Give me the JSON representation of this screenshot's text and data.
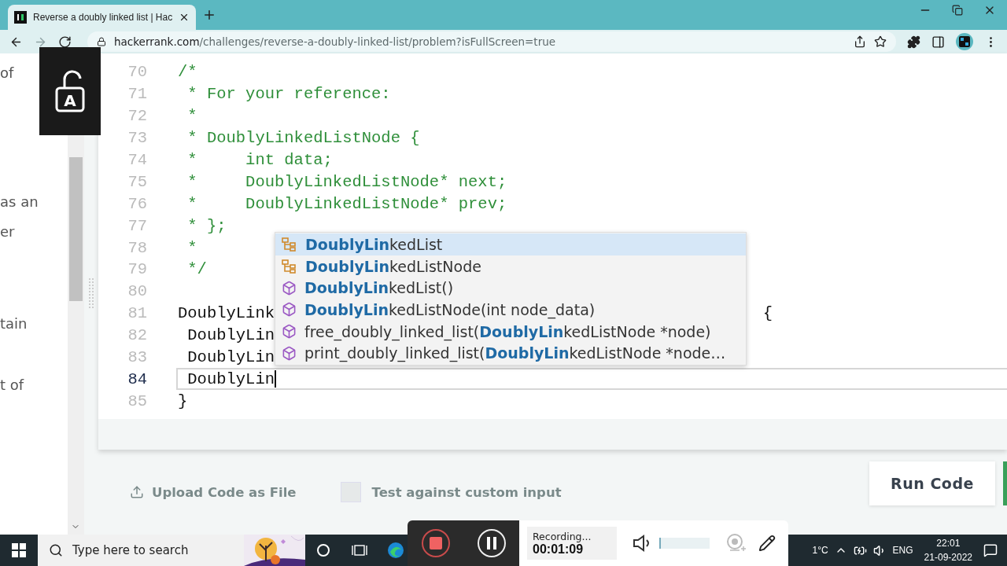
{
  "browser": {
    "tabs": [
      {
        "title": "Reverse a doubly linked list | Hac",
        "selected": true
      }
    ],
    "nav_buttons": [
      {
        "kind": "back",
        "disabled": false
      },
      {
        "kind": "forward",
        "disabled": true
      },
      {
        "kind": "reload",
        "disabled": false
      }
    ],
    "url": {
      "host": "hackerrank.com",
      "path": "/challenges/reverse-a-doubly-linked-list/problem?isFullScreen=true"
    }
  },
  "lock_overlay": {
    "letter": "A"
  },
  "problem_pane": {
    "fragments": [
      "of",
      "as an",
      "er",
      "tain",
      "t of"
    ]
  },
  "editor": {
    "lines": [
      {
        "number": "70",
        "kind": "comment",
        "text": "/*",
        "current": false
      },
      {
        "number": "71",
        "kind": "comment",
        "text": " * For your reference:",
        "current": false
      },
      {
        "number": "72",
        "kind": "comment",
        "text": " *",
        "current": false
      },
      {
        "number": "73",
        "kind": "comment",
        "text": " * DoublyLinkedListNode {",
        "current": false
      },
      {
        "number": "74",
        "kind": "comment",
        "text": " *     int data;",
        "current": false
      },
      {
        "number": "75",
        "kind": "comment",
        "text": " *     DoublyLinkedListNode* next;",
        "current": false
      },
      {
        "number": "76",
        "kind": "comment",
        "text": " *     DoublyLinkedListNode* prev;",
        "current": false
      },
      {
        "number": "77",
        "kind": "comment",
        "text": " * };",
        "current": false
      },
      {
        "number": "78",
        "kind": "comment",
        "text": " *",
        "current": false
      },
      {
        "number": "79",
        "kind": "comment",
        "text": " */",
        "current": false
      },
      {
        "number": "80",
        "current": false
      },
      {
        "number": "81",
        "kind": "code",
        "text": "DoublyLink",
        "trail": "{",
        "current": false
      },
      {
        "number": "82",
        "kind": "code",
        "text": " DoublyLin",
        "current": false
      },
      {
        "number": "83",
        "kind": "code",
        "text": " DoublyLin",
        "current": false
      },
      {
        "number": "84",
        "kind": "code",
        "text": " DoublyLin",
        "current": true
      },
      {
        "number": "85",
        "kind": "code",
        "text": "}",
        "current": false
      }
    ],
    "suggestions": [
      {
        "kind": "class",
        "label": "**DoublyLin**kedList",
        "selected": true
      },
      {
        "kind": "class",
        "label": "**DoublyLin**kedListNode",
        "selected": false
      },
      {
        "kind": "method",
        "label": "**DoublyLin**kedList()",
        "selected": false
      },
      {
        "kind": "method",
        "label": "**DoublyLin**kedListNode(int node_data)",
        "selected": false
      },
      {
        "kind": "method",
        "label": "free_doubly_linked_list(**DoublyLin**kedListNode *node)",
        "selected": false
      },
      {
        "kind": "method",
        "label": "print_doubly_linked_list(**DoublyLin**kedListNode *node…",
        "selected": false
      }
    ]
  },
  "actions": {
    "upload": "Upload Code as File",
    "custom_input": {
      "label": "Test against custom input",
      "checked": false
    },
    "run": "Run Code"
  },
  "recorder": {
    "status": "Recording...",
    "elapsed": "00:01:09",
    "mic_meter": {
      "level": 0.02
    }
  },
  "taskbar": {
    "search_placeholder": "Type here to search",
    "weather": "1°C",
    "language": "ENG",
    "time": "22:01",
    "date": "21-09-2022"
  }
}
